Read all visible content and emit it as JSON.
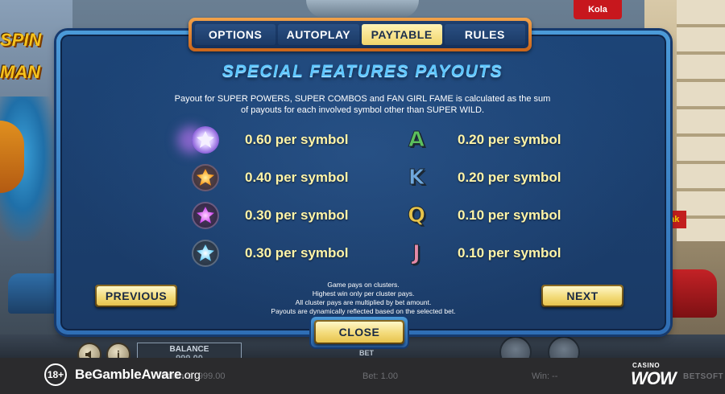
{
  "tabs": {
    "items": [
      {
        "label": "OPTIONS",
        "active": false
      },
      {
        "label": "AUTOPLAY",
        "active": false
      },
      {
        "label": "PAYTABLE",
        "active": true
      },
      {
        "label": "RULES",
        "active": false
      }
    ]
  },
  "title": "SPECIAL FEATURES PAYOUTS",
  "description": {
    "line1": "Payout for SUPER POWERS, SUPER COMBOS and FAN GIRL FAME is calculated as the sum",
    "line2": "of payouts for each involved symbol other than SUPER WILD."
  },
  "payouts_left": [
    {
      "symbol": "white-crystal-icon",
      "value": "0.60 per symbol"
    },
    {
      "symbol": "orange-crystal-icon",
      "value": "0.40 per symbol"
    },
    {
      "symbol": "purple-crystal-icon",
      "value": "0.30 per symbol"
    },
    {
      "symbol": "blue-crystal-icon",
      "value": "0.30 per symbol"
    }
  ],
  "payouts_right": [
    {
      "symbol": "A",
      "color": "#5cc05c",
      "value": "0.20 per symbol"
    },
    {
      "symbol": "K",
      "color": "#6fa8dc",
      "value": "0.20 per symbol"
    },
    {
      "symbol": "Q",
      "color": "#e6c34a",
      "value": "0.10 per symbol"
    },
    {
      "symbol": "J",
      "color": "#e58aa8",
      "value": "0.10 per symbol"
    }
  ],
  "buttons": {
    "previous": "PREVIOUS",
    "next": "NEXT",
    "close": "CLOSE"
  },
  "notes": [
    "Game pays on clusters.",
    "Highest win only per cluster pays.",
    "All cluster pays are multiplied by bet amount.",
    "Payouts are dynamically reflected based on the selected bet."
  ],
  "controls": {
    "balance_label": "BALANCE",
    "balance_value": "999.00",
    "bet_label": "BET"
  },
  "footer": {
    "age": "18+",
    "gamble_aware": "BeGambleAware",
    "gamble_aware_org": ".org",
    "balance_text": "Balance: 999.00",
    "bet_text": "Bet: 1.00",
    "win_text": "Win: --",
    "casino_label": "CASINO",
    "casino_brand": "WOW",
    "provider": "BETSOFT"
  },
  "background": {
    "game_logo": "SPIN MAN",
    "sign_cola": "Kola",
    "sign_kodak": "kotak"
  },
  "colors": {
    "panel_border": "#2f6eb5",
    "panel_bg": "#1a3a66",
    "title": "#5ec6ff",
    "payout_text": "#fff4a8",
    "button_face": "#f3db7a",
    "tab_frame": "#f2a24a"
  }
}
